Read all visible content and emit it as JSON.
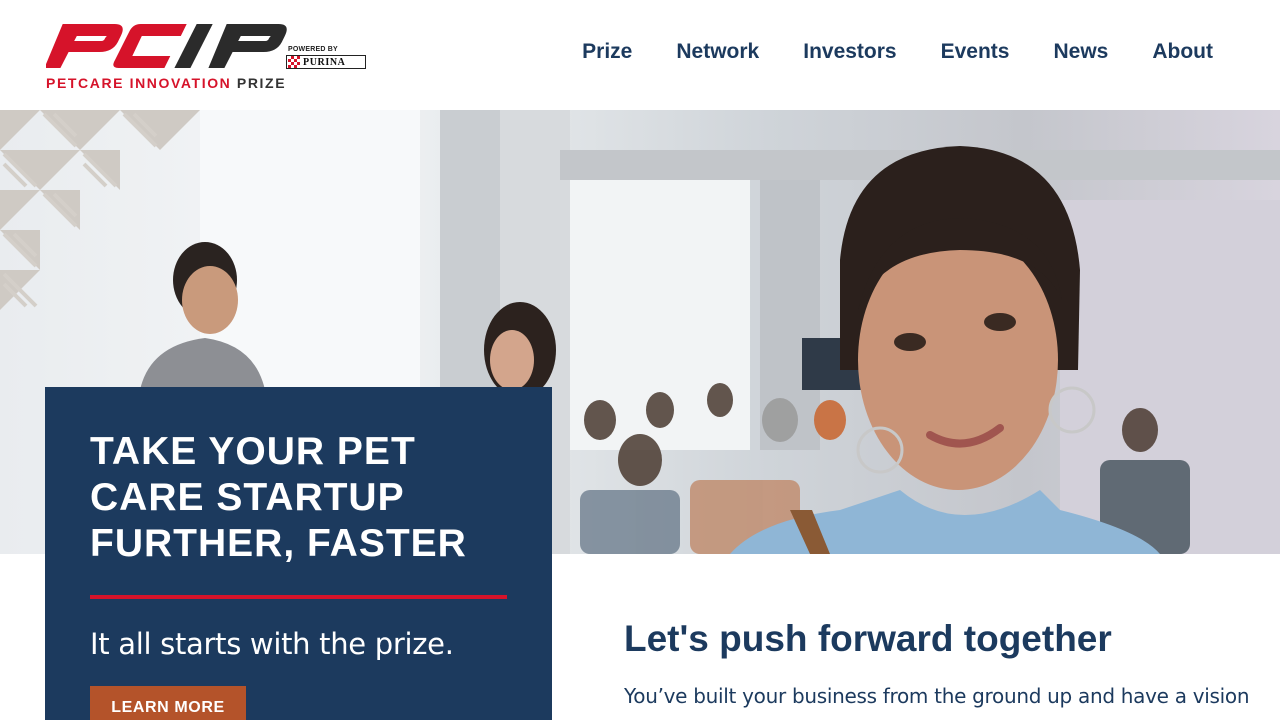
{
  "brand": {
    "logo_text": "PCIP",
    "powered_by": "POWERED BY",
    "purina": "PURINA",
    "tagline_red": "PETCARE INNOVATION",
    "tagline_dark": "PRIZE",
    "colors": {
      "primary": "#1c3a5e",
      "accent": "#d6132a",
      "button": "#b4532a"
    }
  },
  "nav": {
    "items": [
      {
        "label": "Prize"
      },
      {
        "label": "Network"
      },
      {
        "label": "Investors"
      },
      {
        "label": "Events"
      },
      {
        "label": "News"
      },
      {
        "label": "About"
      }
    ]
  },
  "hero": {
    "title": "TAKE YOUR PET CARE STARTUP FURTHER, FASTER",
    "subtitle": "It all starts with the prize.",
    "button_label": "LEARN MORE"
  },
  "intro": {
    "title": "Let's push forward together",
    "text": "You’ve built your business from the ground up and have a vision"
  }
}
